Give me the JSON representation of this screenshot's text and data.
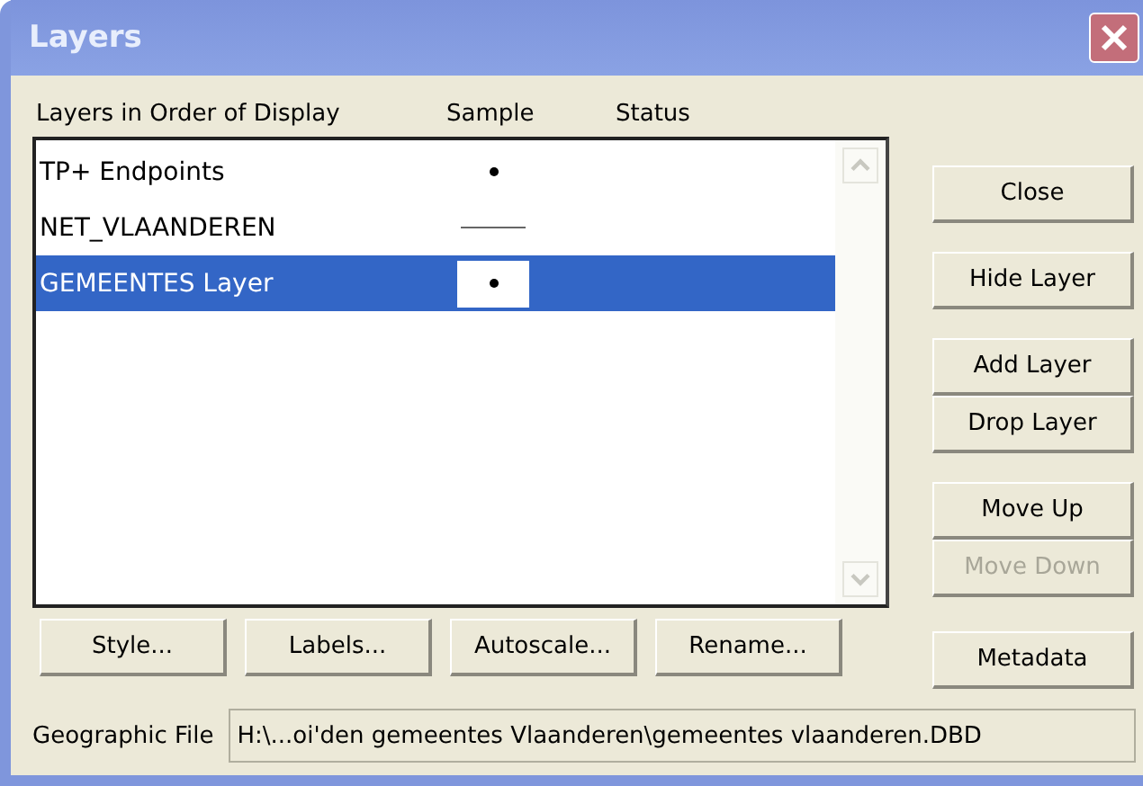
{
  "window": {
    "title": "Layers"
  },
  "columns": [
    "Layers in Order of Display",
    "Sample",
    "Status"
  ],
  "layers": [
    {
      "name": "TP+ Endpoints",
      "kind": "point",
      "selected": false
    },
    {
      "name": "NET_VLAANDEREN",
      "kind": "line",
      "selected": false
    },
    {
      "name": "GEMEENTES Layer",
      "kind": "point",
      "selected": true
    }
  ],
  "side_button_groups": [
    [
      {
        "label": "Close",
        "disabled": false
      }
    ],
    [
      {
        "label": "Hide Layer",
        "disabled": false
      }
    ],
    [
      {
        "label": "Add Layer",
        "disabled": false
      },
      {
        "label": "Drop Layer",
        "disabled": false
      }
    ],
    [
      {
        "label": "Move Up",
        "disabled": false
      },
      {
        "label": "Move Down",
        "disabled": true
      }
    ]
  ],
  "bottom_buttons": [
    "Style...",
    "Labels...",
    "Autoscale...",
    "Rename..."
  ],
  "metadata_button": "Metadata",
  "geographic_file": {
    "label": "Geographic File",
    "value": "H:\\...oi'den gemeentes Vlaanderen\\gemeentes vlaanderen.DBD"
  }
}
